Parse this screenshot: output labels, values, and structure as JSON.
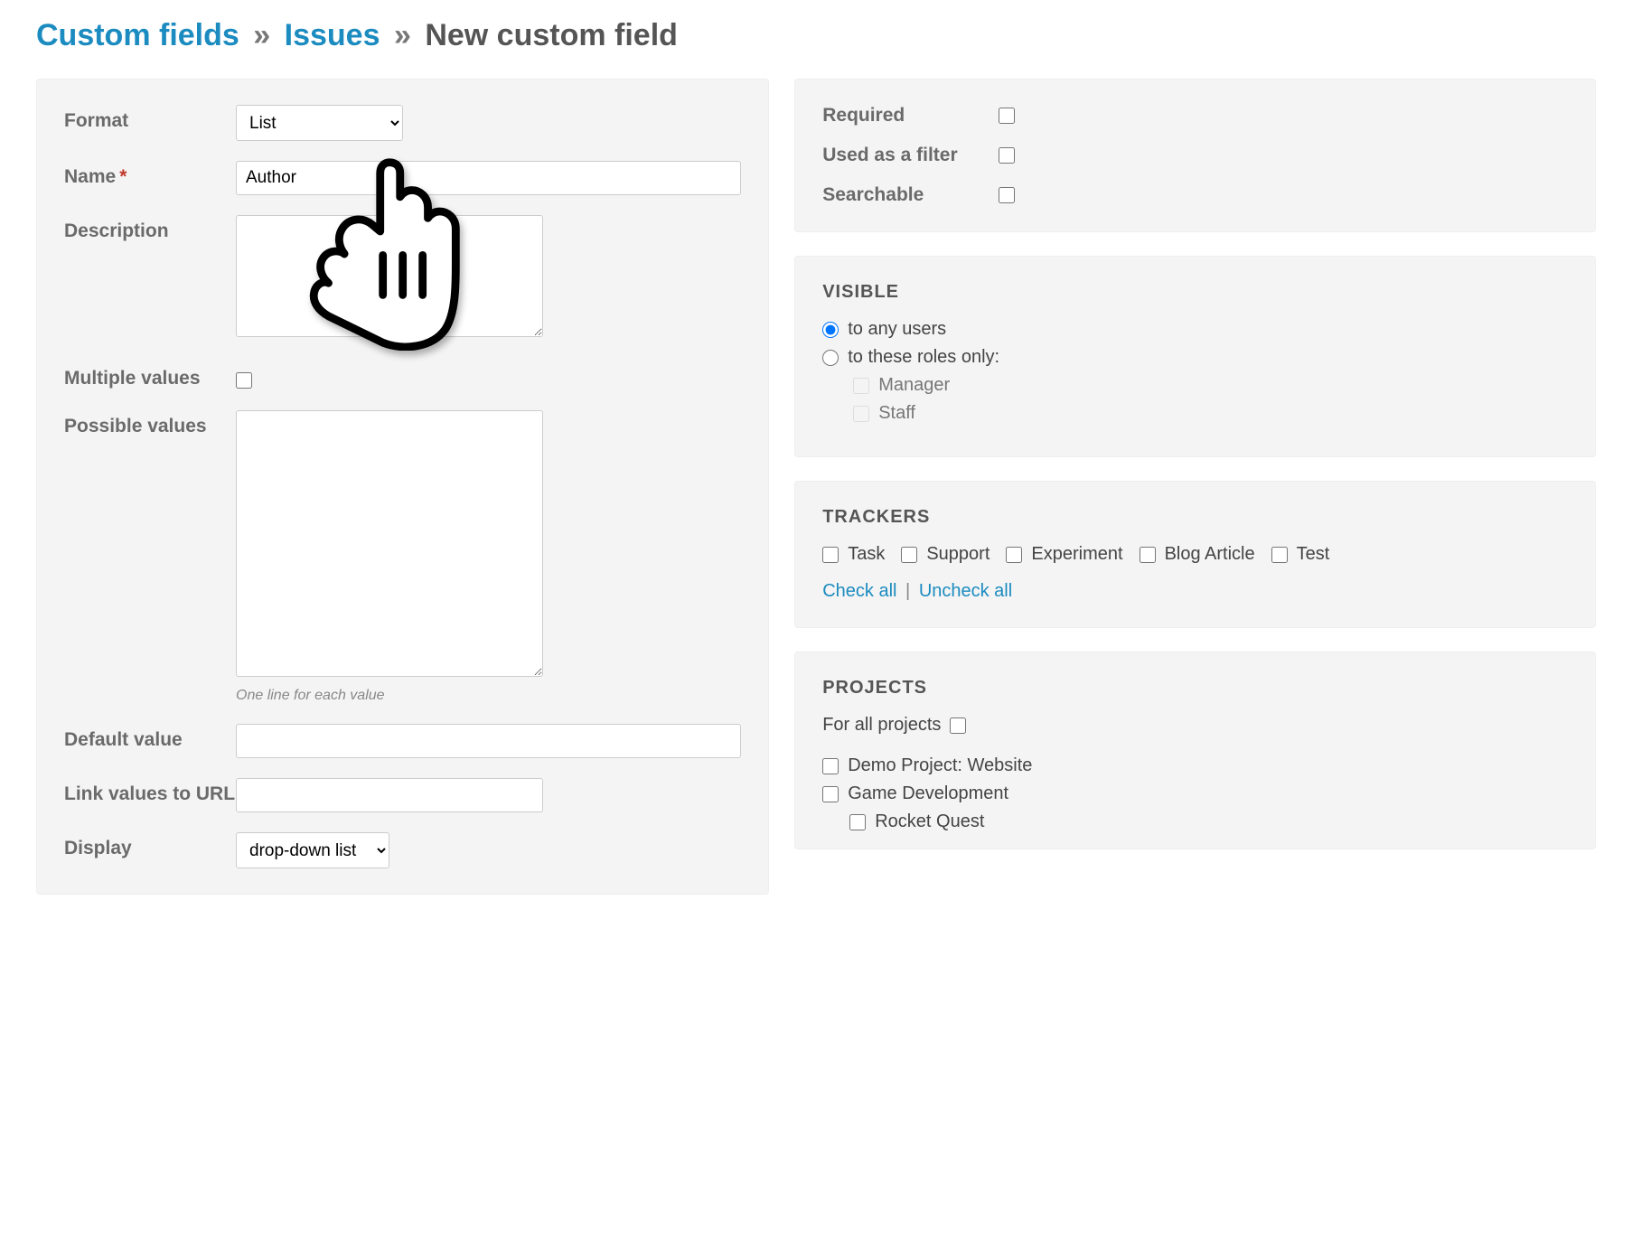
{
  "breadcrumb": {
    "root": "Custom fields",
    "mid": "Issues",
    "current": "New custom field"
  },
  "left": {
    "format_label": "Format",
    "format_value": "List",
    "name_label": "Name",
    "name_value": "Author",
    "description_label": "Description",
    "multiple_label": "Multiple values",
    "possible_label": "Possible values",
    "possible_hint": "One line for each value",
    "default_label": "Default value",
    "link_label": "Link values to URL",
    "display_label": "Display",
    "display_value": "drop-down list"
  },
  "flags": {
    "required": "Required",
    "used_filter": "Used as a filter",
    "searchable": "Searchable"
  },
  "visible": {
    "title": "Visible",
    "any": "to any users",
    "roles": "to these roles only:",
    "role_manager": "Manager",
    "role_staff": "Staff"
  },
  "trackers": {
    "title": "Trackers",
    "items": [
      "Task",
      "Support",
      "Experiment",
      "Blog Article",
      "Test"
    ],
    "check_all": "Check all",
    "uncheck_all": "Uncheck all"
  },
  "projects": {
    "title": "Projects",
    "for_all": "For all projects",
    "items": [
      "Demo Project: Website",
      "Game Development"
    ],
    "sub_items": [
      "Rocket Quest"
    ]
  }
}
